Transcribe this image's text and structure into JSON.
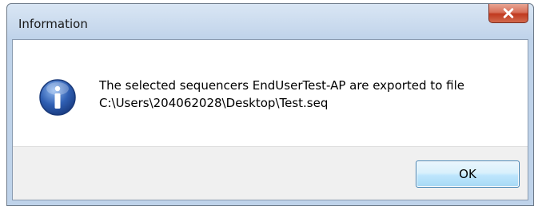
{
  "window": {
    "title": "Information"
  },
  "icons": {
    "close": "close-icon",
    "info": "info-icon"
  },
  "message": {
    "line1": "The selected sequencers EndUserTest-AP are exported to file",
    "line2": "C:\\Users\\204062028\\Desktop\\Test.seq"
  },
  "buttons": {
    "ok_label": "OK"
  },
  "colors": {
    "accent": "#3c7fb1",
    "close_button": "#c0391f",
    "info_icon": "#2f5fb3"
  }
}
